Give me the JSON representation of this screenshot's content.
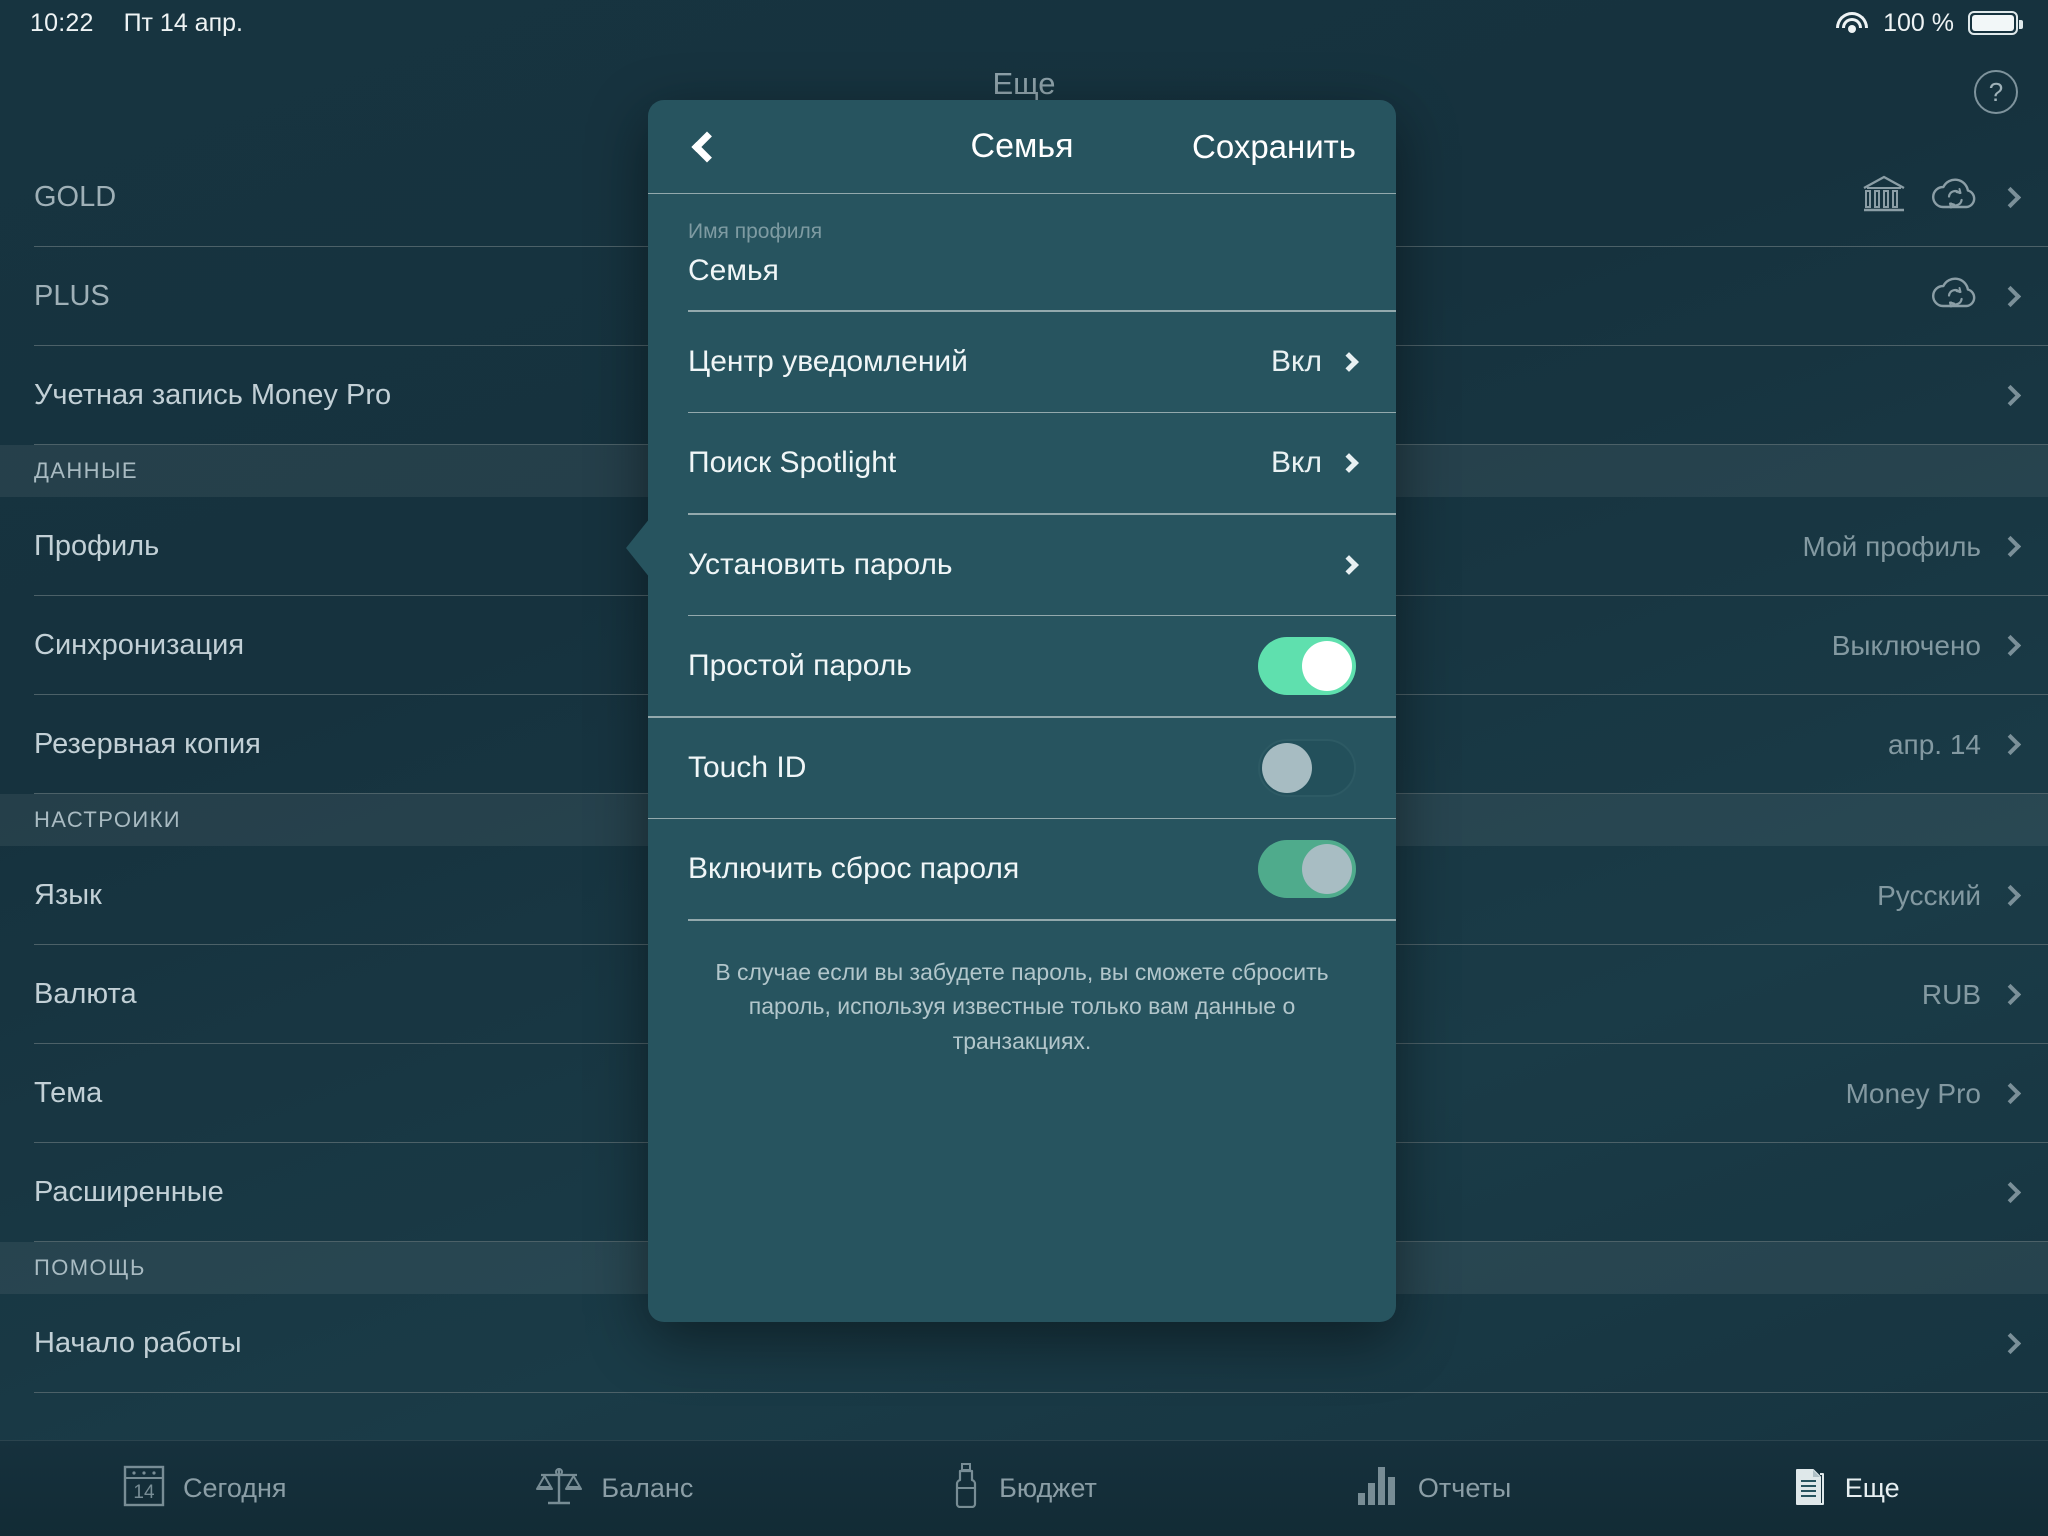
{
  "statusbar": {
    "time": "10:22",
    "date": "Пт 14 апр.",
    "battery_percent": "100 %",
    "wifi_icon": "wifi-icon",
    "battery_icon": "battery-full-icon"
  },
  "page": {
    "title": "Еще",
    "help_label": "?"
  },
  "settings_list": [
    {
      "type": "row",
      "label": "GOLD",
      "value": "",
      "icons": [
        "bank-icon",
        "cloud-sync-icon"
      ],
      "chevron": true
    },
    {
      "type": "row",
      "label": "PLUS",
      "value": "",
      "icons": [
        "cloud-sync-icon"
      ],
      "chevron": true
    },
    {
      "type": "row",
      "label": "Учетная запись Money Pro",
      "value": "",
      "icons": [],
      "chevron": true
    },
    {
      "type": "header",
      "label": "ДАННЫЕ"
    },
    {
      "type": "row",
      "label": "Профиль",
      "value": "Мой профиль",
      "icons": [],
      "chevron": true
    },
    {
      "type": "row",
      "label": "Синхронизация",
      "value": "Выключено",
      "icons": [],
      "chevron": true
    },
    {
      "type": "row",
      "label": "Резервная копия",
      "value": "апр. 14",
      "icons": [],
      "chevron": true
    },
    {
      "type": "header",
      "label": "НАСТРОИКИ"
    },
    {
      "type": "row",
      "label": "Язык",
      "value": "Русский",
      "icons": [],
      "chevron": true
    },
    {
      "type": "row",
      "label": "Валюта",
      "value": "RUB",
      "icons": [],
      "chevron": true
    },
    {
      "type": "row",
      "label": "Тема",
      "value": "Money Pro",
      "icons": [],
      "chevron": true
    },
    {
      "type": "row",
      "label": "Расширенные",
      "value": "",
      "icons": [],
      "chevron": true
    },
    {
      "type": "header",
      "label": "ПОМОЩЬ"
    },
    {
      "type": "row",
      "label": "Начало работы",
      "value": "",
      "icons": [],
      "chevron": true
    }
  ],
  "popover": {
    "back_icon": "back-chevron-icon",
    "title": "Семья",
    "save_label": "Сохранить",
    "profile_name_label": "Имя профиля",
    "profile_name_value": "Семья",
    "rows": [
      {
        "label": "Центр уведомлений",
        "value": "Вкл",
        "kind": "disclosure"
      },
      {
        "label": "Поиск Spotlight",
        "value": "Вкл",
        "kind": "disclosure"
      },
      {
        "label": "Установить пароль",
        "value": "",
        "kind": "disclosure"
      },
      {
        "label": "Простой пароль",
        "value": "",
        "kind": "toggle",
        "state": "on"
      },
      {
        "label": "Touch ID",
        "value": "",
        "kind": "toggle",
        "state": "off"
      },
      {
        "label": "Включить сброс пароля",
        "value": "",
        "kind": "toggle",
        "state": "on-dim"
      }
    ],
    "footnote": "В случае если вы забудете пароль, вы сможете сбросить пароль, используя известные только вам данные о транзакциях."
  },
  "tabbar": [
    {
      "label": "Сегодня",
      "icon": "calendar-icon",
      "icon_day": "14",
      "active": false
    },
    {
      "label": "Баланс",
      "icon": "scales-icon",
      "active": false
    },
    {
      "label": "Бюджет",
      "icon": "bottle-icon",
      "active": false
    },
    {
      "label": "Отчеты",
      "icon": "bar-chart-icon",
      "active": false
    },
    {
      "label": "Еще",
      "icon": "documents-icon",
      "active": true
    }
  ],
  "colors": {
    "background": "#16323e",
    "popover": "#27545f",
    "toggle_on": "#5fe0ae",
    "toggle_on_dim": "#4fab8c",
    "toggle_off_track": "#23505b",
    "text_primary": "#f0f6f7",
    "text_muted": "#8fa3ab"
  }
}
